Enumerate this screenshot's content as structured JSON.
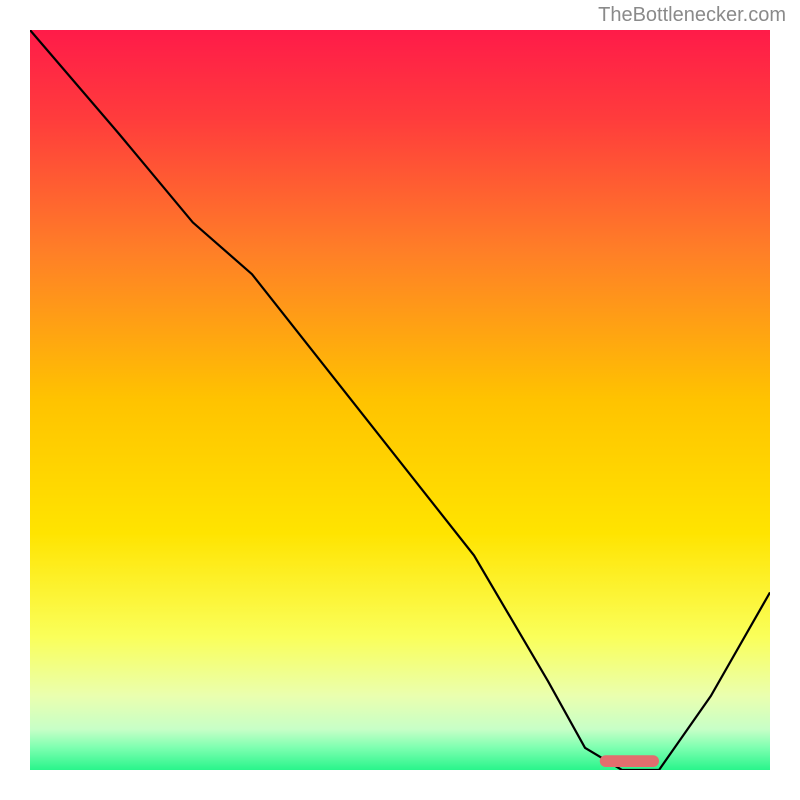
{
  "watermark": "TheBottlenecker.com",
  "chart_data": {
    "type": "line",
    "title": "",
    "xlabel": "",
    "ylabel": "",
    "xlim": [
      0,
      100
    ],
    "ylim": [
      0,
      100
    ],
    "grid": false,
    "background_gradient": {
      "stops": [
        {
          "offset": 0.0,
          "color": "#ff1b49"
        },
        {
          "offset": 0.12,
          "color": "#ff3c3c"
        },
        {
          "offset": 0.3,
          "color": "#ff7f27"
        },
        {
          "offset": 0.5,
          "color": "#ffc300"
        },
        {
          "offset": 0.68,
          "color": "#ffe400"
        },
        {
          "offset": 0.82,
          "color": "#faff5a"
        },
        {
          "offset": 0.9,
          "color": "#eaffaf"
        },
        {
          "offset": 0.945,
          "color": "#c7ffc7"
        },
        {
          "offset": 0.97,
          "color": "#7dffb0"
        },
        {
          "offset": 1.0,
          "color": "#29f58b"
        }
      ]
    },
    "series": [
      {
        "name": "bottleneck-curve",
        "color": "#000000",
        "width": 2.2,
        "x": [
          0,
          12,
          22,
          30,
          45,
          60,
          70,
          75,
          80,
          85,
          92,
          100
        ],
        "values": [
          100,
          86,
          74,
          67,
          48,
          29,
          12,
          3,
          0,
          0,
          10,
          24
        ]
      }
    ],
    "marker": {
      "name": "optimal-range",
      "x_start": 77,
      "x_end": 85,
      "y": 1.2,
      "color": "#e26e6e",
      "thickness": 1.6
    }
  }
}
